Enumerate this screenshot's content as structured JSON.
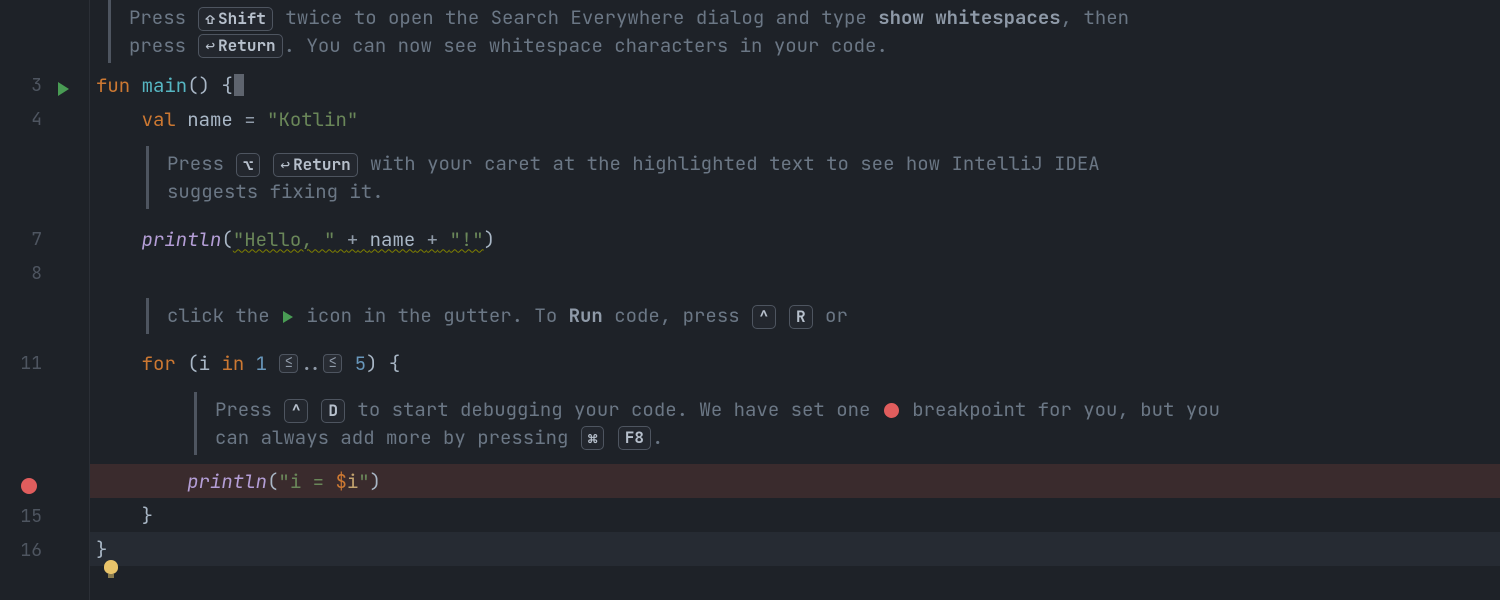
{
  "gutter": {
    "lines": {
      "l3": "3",
      "l4": "4",
      "l7": "7",
      "l8": "8",
      "l11": "11",
      "l15": "15",
      "l16": "16"
    }
  },
  "hints": {
    "shift": "Shift",
    "return": "Return",
    "option": "⌥",
    "ctrl": "^",
    "r": "R",
    "d": "D",
    "cmd": "⌘",
    "f8": "F8",
    "lte": "≤"
  },
  "comments": {
    "c1_a": "Press ",
    "c1_b": " twice to open the Search Everywhere dialog and type ",
    "c1_bold1": "show whitespaces",
    "c1_c": ", then press ",
    "c1_d": ". You can now see whitespace characters in your code.",
    "c2_a": "Press ",
    "c2_b": " with your caret at the highlighted text to see how IntelliJ IDEA suggests fixing it.",
    "c3_a": "click the ",
    "c3_b": " icon in the gutter. To ",
    "c3_bold1": "Run",
    "c3_c": " code, press ",
    "c3_d": " or",
    "c4_a": "Press ",
    "c4_b": " to start debugging your code. We have set one ",
    "c4_c": " breakpoint for you, but you can always add more by pressing ",
    "c4_d": "."
  },
  "code": {
    "l3": {
      "kw": "fun",
      "sp1": " ",
      "fn": "main",
      "paren": "()",
      "sp2": " ",
      "brc": "{"
    },
    "l4": {
      "indent": "    ",
      "kw": "val",
      "sp1": " ",
      "var": "name",
      "sp2": " ",
      "op": "=",
      "sp3": " ",
      "str": "\"Kotlin\""
    },
    "l7": {
      "indent": "    ",
      "fn": "println",
      "po": "(",
      "s1": "\"Hello, \"",
      "sp1": " ",
      "op1": "+",
      "sp2": " ",
      "var": "name",
      "sp3": " ",
      "op2": "+",
      "sp4": " ",
      "s2": "\"!\"",
      "pc": ")"
    },
    "l11": {
      "indent": "    ",
      "kw": "for",
      "sp1": " ",
      "po": "(",
      "var": "i",
      "sp2": " ",
      "kw2": "in",
      "sp3": " ",
      "n1": "1",
      "sp4": " ",
      "range": "..",
      "sp5": " ",
      "n2": "5",
      "pc": ")",
      "sp6": " ",
      "brc": "{"
    },
    "l14": {
      "indent": "        ",
      "fn": "println",
      "po": "(",
      "s1": "\"i = ",
      "tpl": "$",
      "tvar": "i",
      "s2": "\"",
      "pc": ")"
    },
    "l15": {
      "indent": "    ",
      "brc": "}"
    },
    "l16": {
      "brc": "}"
    }
  }
}
